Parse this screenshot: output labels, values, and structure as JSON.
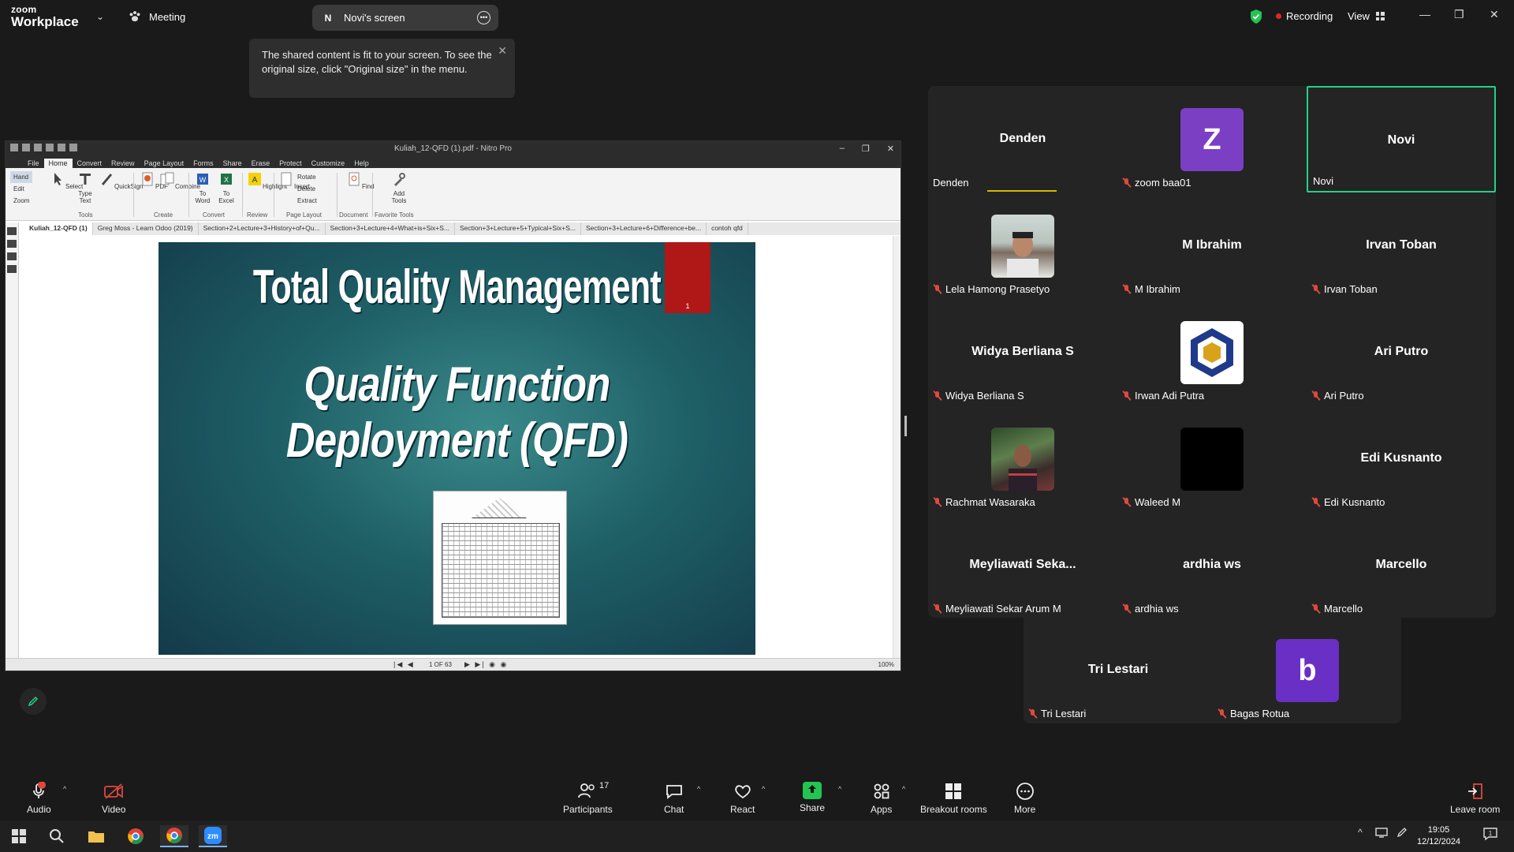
{
  "topbar": {
    "brand_top": "zoom",
    "brand_bottom": "Workplace",
    "meeting_label": "Meeting",
    "screen_initial": "N",
    "screen_label": "Novi's screen",
    "recording_label": "Recording",
    "view_label": "View"
  },
  "tooltip": {
    "text": "The shared content is fit to your screen. To see the original size, click \"Original size\" in the menu."
  },
  "nitro": {
    "title": "Kuliah_12-QFD (1).pdf - Nitro Pro",
    "menu": [
      "File",
      "Home",
      "Convert",
      "Review",
      "Page Layout",
      "Forms",
      "Share",
      "Erase",
      "Protect",
      "Customize",
      "Help"
    ],
    "ribbon": {
      "hand": "Hand",
      "edit": "Edit",
      "zoom": "Zoom",
      "select": "Select",
      "type_text": "Type Text",
      "quicksign": "QuickSign",
      "pdf": "PDF",
      "combine": "Combine",
      "to_word": "To Word",
      "to_excel": "To Excel",
      "highlight": "Highlight",
      "insert": "Insert",
      "rotate": "Rotate",
      "delete": "Delete",
      "extract": "Extract",
      "find": "Find",
      "add_tools": "Add Tools",
      "groups": [
        "Tools",
        "Create",
        "Convert",
        "Review",
        "Page Layout",
        "Document",
        "Favorite Tools"
      ]
    },
    "tabs": [
      "Kuliah_12-QFD (1)",
      "Greg Moss - Learn Odoo (2019)",
      "Section+2+Lecture+3+History+of+Qu...",
      "Section+3+Lecture+4+What+is+Six+S...",
      "Section+3+Lecture+5+Typical+Six+S...",
      "Section+3+Lecture+6+Difference+be...",
      "contoh qfd"
    ],
    "slide": {
      "title1": "Total Quality Management",
      "title2": "Quality Function Deployment (QFD)",
      "bookmark_num": "1"
    },
    "page_indicator": "1 OF 63",
    "zoom_level": "100%"
  },
  "gallery": {
    "tiles": [
      {
        "display": "Denden",
        "name": "Denden",
        "muted": false,
        "type": "text"
      },
      {
        "display": "Z",
        "name": "zoom baa01",
        "muted": true,
        "type": "letter",
        "color": "#7b3fc4"
      },
      {
        "display": "Novi",
        "name": "Novi",
        "muted": false,
        "type": "text",
        "active": true
      },
      {
        "display": "",
        "name": "Lela Hamong Prasetyo",
        "muted": true,
        "type": "photo1"
      },
      {
        "display": "M Ibrahim",
        "name": "M Ibrahim",
        "muted": true,
        "type": "text"
      },
      {
        "display": "Irvan Toban",
        "name": "Irvan Toban",
        "muted": true,
        "type": "text"
      },
      {
        "display": "Widya Berliana S",
        "name": "Widya Berliana S",
        "muted": true,
        "type": "text"
      },
      {
        "display": "",
        "name": "Irwan Adi Putra",
        "muted": true,
        "type": "logo"
      },
      {
        "display": "Ari Putro",
        "name": "Ari Putro",
        "muted": true,
        "type": "text"
      },
      {
        "display": "",
        "name": "Rachmat Wasaraka",
        "muted": true,
        "type": "photo2"
      },
      {
        "display": "",
        "name": "Waleed M",
        "muted": true,
        "type": "black"
      },
      {
        "display": "Edi Kusnanto",
        "name": "Edi Kusnanto",
        "muted": true,
        "type": "text"
      },
      {
        "display": "Meyliawati  Seka...",
        "name": "Meyliawati Sekar Arum M",
        "muted": true,
        "type": "text"
      },
      {
        "display": "ardhia ws",
        "name": "ardhia ws",
        "muted": true,
        "type": "text"
      },
      {
        "display": "Marcello",
        "name": "Marcello",
        "muted": true,
        "type": "text"
      },
      {
        "display": "Tri Lestari",
        "name": "Tri Lestari",
        "muted": true,
        "type": "text"
      },
      {
        "display": "b",
        "name": "Bagas Rotua",
        "muted": true,
        "type": "letter",
        "color": "#6a2fc4"
      }
    ]
  },
  "toolbar": {
    "audio": "Audio",
    "video": "Video",
    "participants": "Participants",
    "participants_count": "17",
    "chat": "Chat",
    "react": "React",
    "share": "Share",
    "apps": "Apps",
    "breakout": "Breakout rooms",
    "more": "More",
    "leave": "Leave room"
  },
  "taskbar": {
    "time": "19:05",
    "date": "12/12/2024",
    "notification_count": "1"
  },
  "colors": {
    "active_speaker": "#23d18b",
    "muted_red": "#e0483e",
    "share_green": "#23c552",
    "recording_red": "#e02828"
  }
}
